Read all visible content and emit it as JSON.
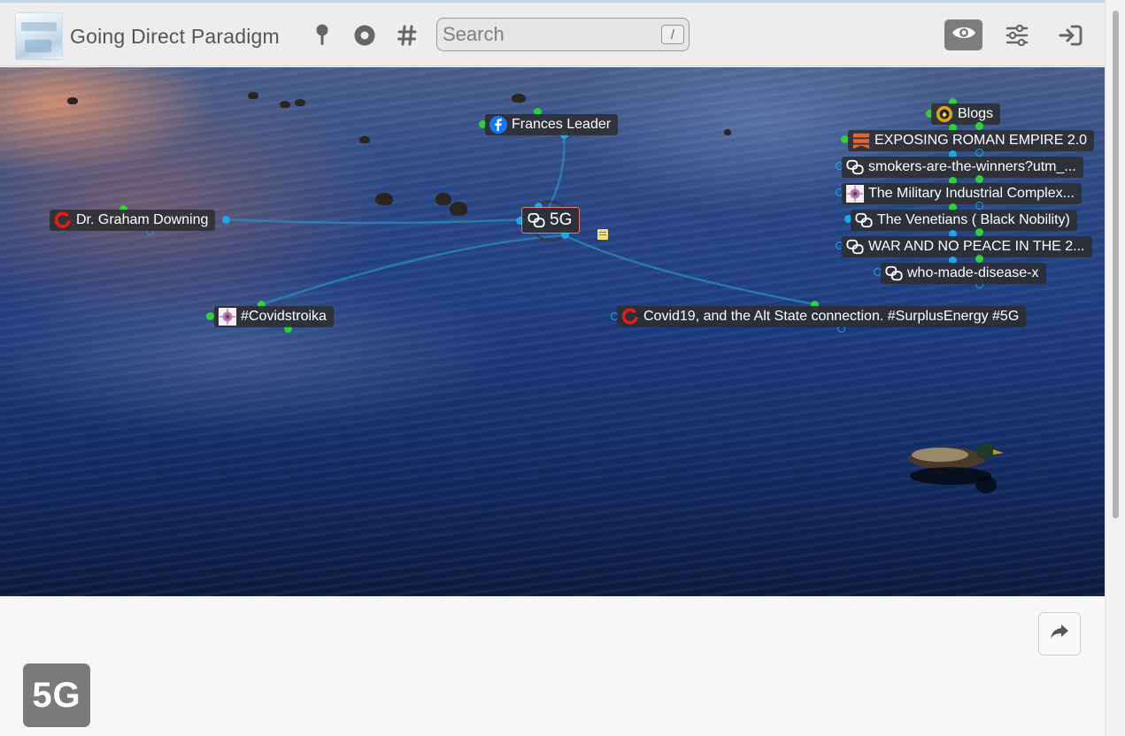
{
  "header": {
    "title": "Going Direct Paradigm",
    "search_placeholder": "Search",
    "search_shortcut": "/",
    "icons": [
      "pin-icon",
      "circle-icon",
      "hashtag-icon",
      "eye-icon",
      "sliders-icon",
      "sign-in-icon"
    ]
  },
  "graph": {
    "center": "5G",
    "nodes": [
      {
        "key": "frances",
        "label": "Frances Leader",
        "icon": "facebook-icon"
      },
      {
        "key": "graham",
        "label": "Dr. Graham Downing",
        "icon": "red-ring-icon"
      },
      {
        "key": "covidstroika",
        "label": "#Covidstroika",
        "icon": "image-thumbnail-icon"
      },
      {
        "key": "covid19",
        "label": "Covid19, and the Alt State connection. #SurplusEnergy #5G",
        "icon": "red-ring-icon"
      },
      {
        "key": "blogs",
        "label": "Blogs",
        "icon": "blogs-emblem-icon"
      },
      {
        "key": "exposing",
        "label": "EXPOSING ROMAN EMPIRE 2.0",
        "icon": "ribbon-icon"
      },
      {
        "key": "smokers",
        "label": "smokers-are-the-winners?utm_...",
        "icon": "link-chain-icon"
      },
      {
        "key": "military",
        "label": "The Military Industrial Complex...",
        "icon": "image-thumbnail-icon"
      },
      {
        "key": "venetians",
        "label": "The Venetians ( Black Nobility)",
        "icon": "link-chain-icon"
      },
      {
        "key": "war",
        "label": "WAR AND NO PEACE IN THE 2...",
        "icon": "link-chain-icon"
      },
      {
        "key": "disease",
        "label": "who-made-disease-x",
        "icon": "link-chain-icon"
      }
    ]
  },
  "footer": {
    "badge": "5G",
    "share_icon": "share-arrow-icon"
  },
  "colors": {
    "link_dot": "#1ea7e8",
    "tag_dot": "#2fd03a",
    "center_border": "#e08080"
  }
}
